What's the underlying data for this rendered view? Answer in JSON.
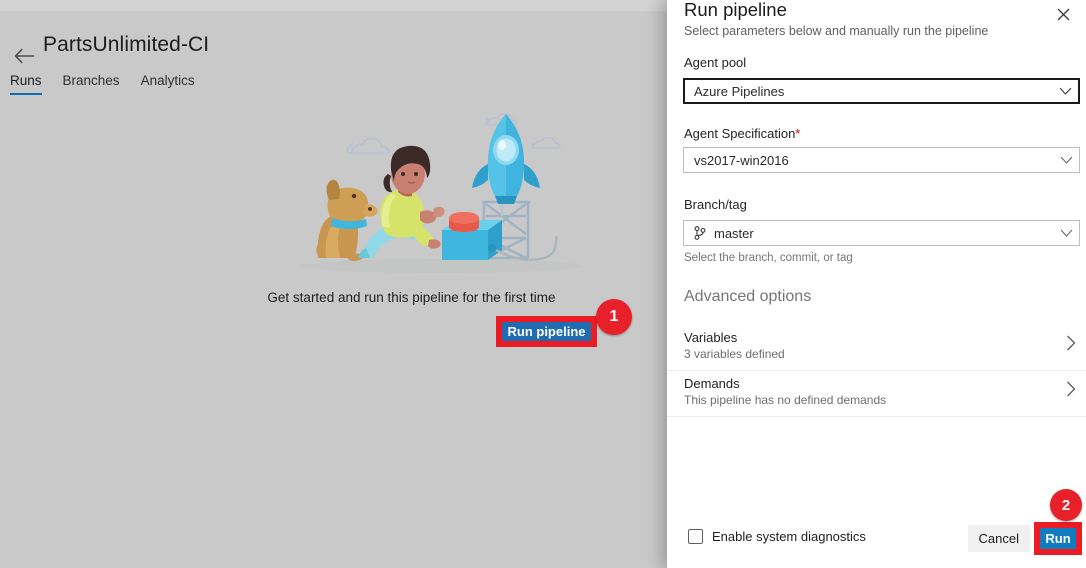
{
  "app": {
    "back_icon": "back-arrow-icon",
    "title": "PartsUnlimited-CI",
    "tabs": [
      {
        "label": "Runs",
        "active": true
      },
      {
        "label": "Branches",
        "active": false
      },
      {
        "label": "Analytics",
        "active": false
      }
    ],
    "empty_state": {
      "message": "Get started and run this pipeline for the first time",
      "run_button_label": "Run pipeline",
      "illustration": "person-dog-rocket-launch-illustration"
    },
    "accent_color": "#0d6cb4"
  },
  "panel": {
    "title": "Run pipeline",
    "subtitle": "Select parameters below and manually run the pipeline",
    "close_icon": "close-icon",
    "fields": {
      "agent_pool": {
        "label": "Agent pool",
        "value": "Azure Pipelines",
        "chevron_icon": "chevron-down-icon"
      },
      "agent_spec": {
        "label": "Agent Specification",
        "required_marker": "*",
        "value": "vs2017-win2016",
        "chevron_icon": "chevron-down-icon"
      },
      "branch": {
        "label": "Branch/tag",
        "value": "master",
        "hint": "Select the branch, commit, or tag",
        "branch_icon": "git-branch-icon",
        "chevron_icon": "chevron-down-icon"
      }
    },
    "advanced": {
      "heading": "Advanced options",
      "rows": [
        {
          "title": "Variables",
          "subtitle": "3 variables defined",
          "chevron_icon": "chevron-right-icon"
        },
        {
          "title": "Demands",
          "subtitle": "This pipeline has no defined demands",
          "chevron_icon": "chevron-right-icon"
        }
      ]
    },
    "footer": {
      "diagnostics_label": "Enable system diagnostics",
      "diagnostics_checked": false,
      "cancel_label": "Cancel",
      "run_label": "Run"
    }
  },
  "annotations": {
    "badge_one": "1",
    "badge_two": "2",
    "highlight_color": "#ec1c24",
    "badge_color": "#e8202a"
  }
}
